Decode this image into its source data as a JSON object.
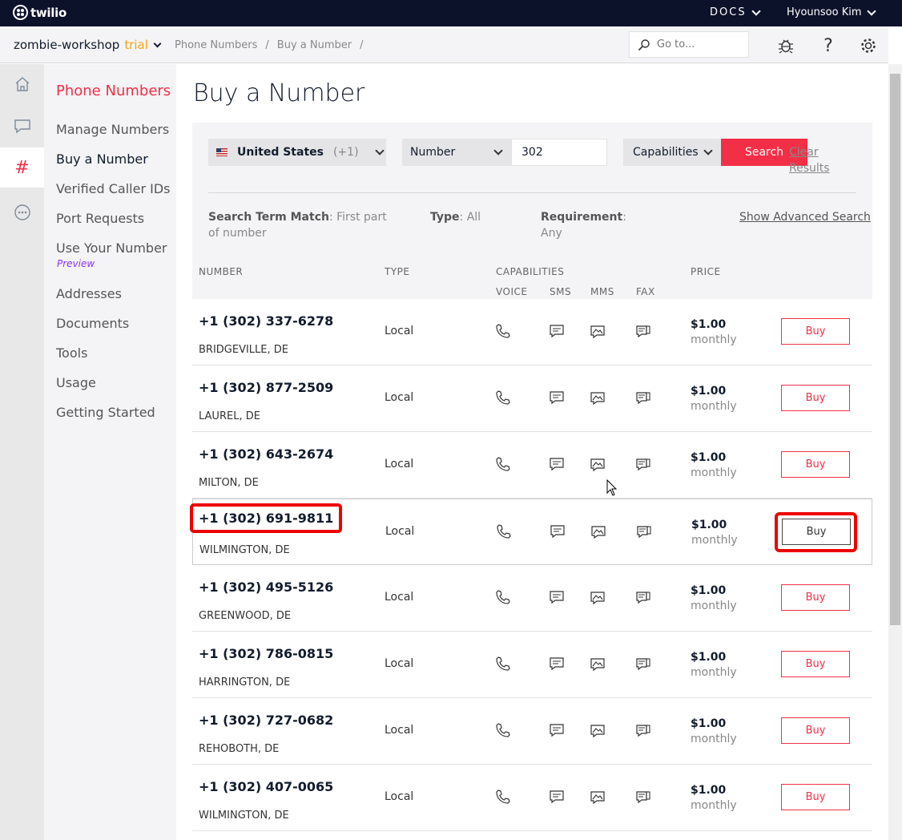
{
  "topbar": {
    "logo": "twilio",
    "docs": "DOCS",
    "user": "Hyounsoo Kim"
  },
  "project": {
    "name": "zombie-workshop",
    "tag": "trial"
  },
  "breadcrumbs": [
    "Phone Numbers",
    "/",
    "Buy a Number",
    "/"
  ],
  "goto_placeholder": "Go to...",
  "sidenav": {
    "title": "Phone Numbers",
    "items": [
      "Manage Numbers",
      "Buy a Number",
      "Verified Caller IDs",
      "Port Requests",
      "Use Your Number",
      "Addresses",
      "Documents",
      "Tools",
      "Usage",
      "Getting Started"
    ],
    "preview": "Preview"
  },
  "page_title": "Buy a Number",
  "filter": {
    "country": "United States",
    "country_code": "(+1)",
    "search_type": "Number",
    "search_value": "302",
    "capabilities": "Capabilities",
    "search_button": "Search",
    "clear_results": "Clear Results",
    "criteria": [
      {
        "label": "Search Term Match",
        "value": ": First part of number"
      },
      {
        "label": "Type",
        "value": ": All"
      },
      {
        "label": "Requirement",
        "value": ": Any"
      }
    ],
    "advanced": "Show Advanced Search"
  },
  "columns": {
    "number": "NUMBER",
    "type": "TYPE",
    "capabilities": "CAPABILITIES",
    "voice": "VOICE",
    "sms": "SMS",
    "mms": "MMS",
    "fax": "FAX",
    "price": "PRICE"
  },
  "rows": [
    {
      "number": "+1 (302) 337-6278",
      "location": "BRIDGEVILLE, DE",
      "type": "Local",
      "price": "$1.00",
      "period": "monthly",
      "buy": "Buy"
    },
    {
      "number": "+1 (302) 877-2509",
      "location": "LAUREL, DE",
      "type": "Local",
      "price": "$1.00",
      "period": "monthly",
      "buy": "Buy"
    },
    {
      "number": "+1 (302) 643-2674",
      "location": "MILTON, DE",
      "type": "Local",
      "price": "$1.00",
      "period": "monthly",
      "buy": "Buy"
    },
    {
      "number": "+1 (302) 691-9811",
      "location": "WILMINGTON, DE",
      "type": "Local",
      "price": "$1.00",
      "period": "monthly",
      "buy": "Buy"
    },
    {
      "number": "+1 (302) 495-5126",
      "location": "GREENWOOD, DE",
      "type": "Local",
      "price": "$1.00",
      "period": "monthly",
      "buy": "Buy"
    },
    {
      "number": "+1 (302) 786-0815",
      "location": "HARRINGTON, DE",
      "type": "Local",
      "price": "$1.00",
      "period": "monthly",
      "buy": "Buy"
    },
    {
      "number": "+1 (302) 727-0682",
      "location": "REHOBOTH, DE",
      "type": "Local",
      "price": "$1.00",
      "period": "monthly",
      "buy": "Buy"
    },
    {
      "number": "+1 (302) 407-0065",
      "location": "WILMINGTON, DE",
      "type": "Local",
      "price": "$1.00",
      "period": "monthly",
      "buy": "Buy"
    }
  ],
  "colors": {
    "brand_red": "#f22f46",
    "topbar": "#0d122b",
    "trial": "#f6a313",
    "highlight": "#e00000"
  }
}
